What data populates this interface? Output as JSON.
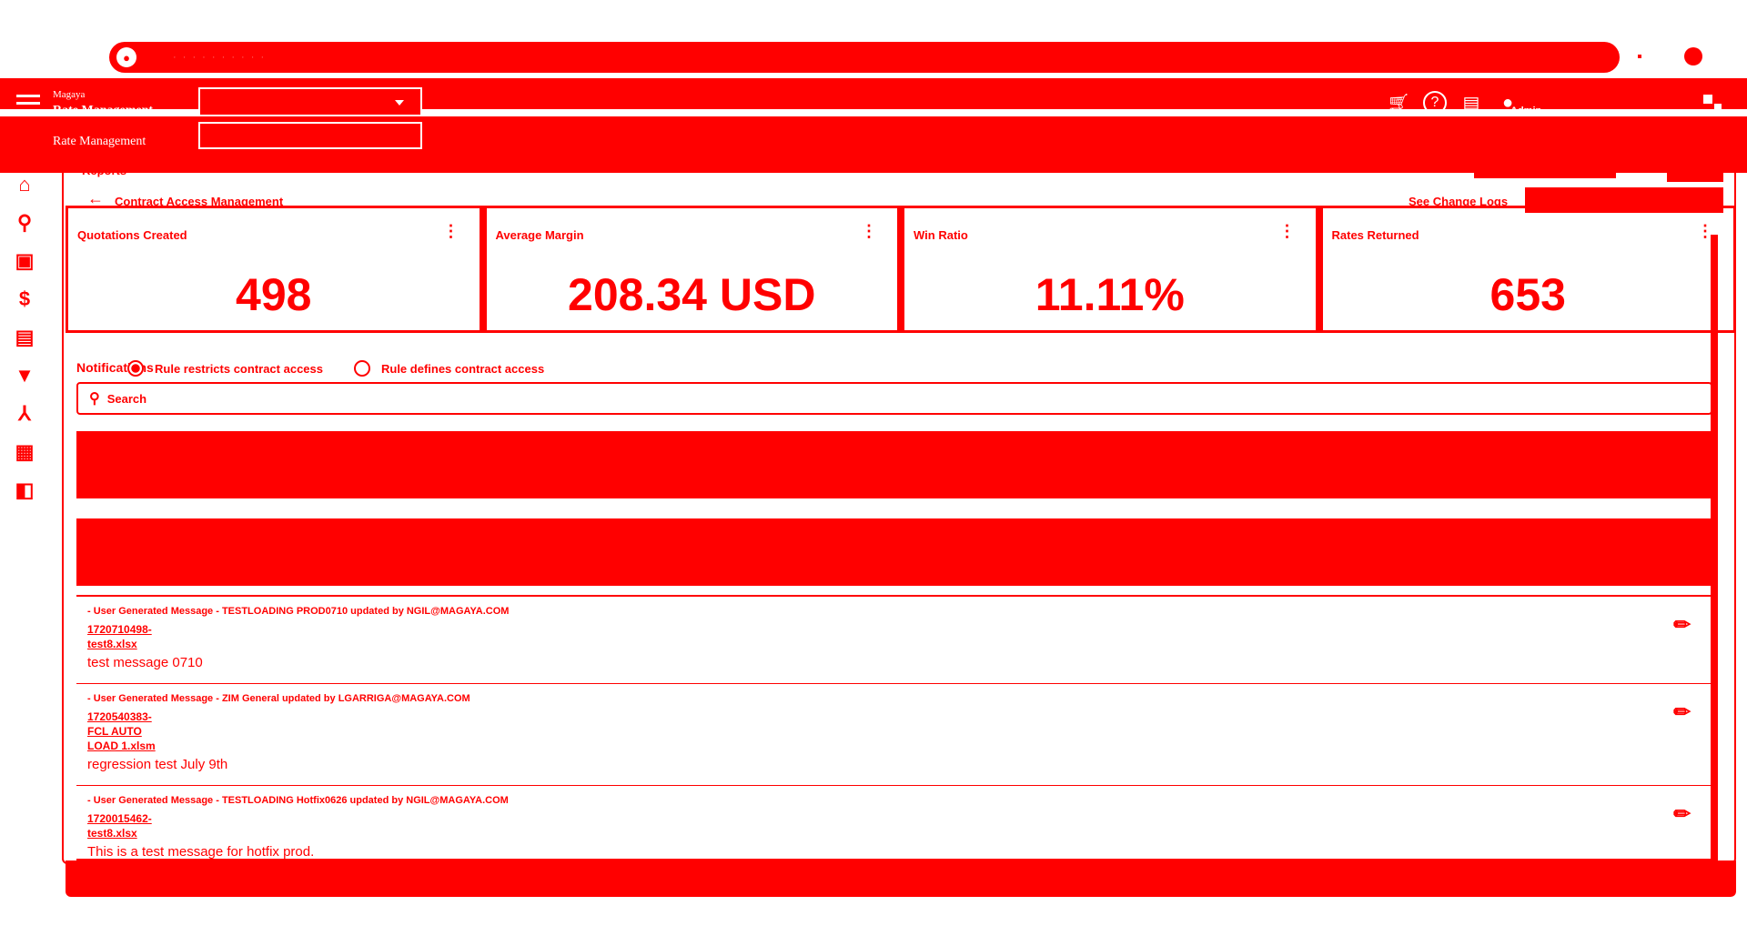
{
  "browser": {
    "url_placeholder": "· · · · · · · · · ·"
  },
  "header": {
    "org_small": "Magaya",
    "app_title": "Rate Management",
    "app_title_secondary": "Rate Management",
    "user_label": "Admin"
  },
  "breadcrumb": {
    "label": "Reports"
  },
  "page": {
    "title": "Contract Access Management",
    "change_logs_link": "See Change Logs"
  },
  "kpis": [
    {
      "title": "Quotations Created",
      "value": "498"
    },
    {
      "title": "Average Margin",
      "value": "208.34 USD"
    },
    {
      "title": "Win Ratio",
      "value": "11.11%"
    },
    {
      "title": "Rates Returned",
      "value": "653"
    }
  ],
  "notifications": {
    "title": "Notifications",
    "radio_restricts": "Rule restricts contract access",
    "radio_defines": "Rule defines contract access",
    "search_placeholder": "Search",
    "items": [
      {
        "meta": "- User Generated Message - TESTLOADING PROD0710 updated by NGIL@MAGAYA.COM",
        "file": "1720710498-test8.xlsx",
        "body": "test message 0710"
      },
      {
        "meta": "- User Generated Message - ZIM General updated by LGARRIGA@MAGAYA.COM",
        "file": "1720540383-FCL AUTO LOAD 1.xlsm",
        "body": "regression test July 9th"
      },
      {
        "meta": "- User Generated Message - TESTLOADING Hotfix0626 updated by NGIL@MAGAYA.COM",
        "file": "1720015462-test8.xlsx",
        "body": "This is a test message for hotfix prod."
      }
    ]
  },
  "icons": {
    "hamburger": "menu-icon",
    "cart": "cart-icon",
    "help": "help-icon",
    "report": "report-icon",
    "user": "user-icon"
  },
  "colors": {
    "primary": "#ff0000",
    "background": "#ffffff"
  }
}
